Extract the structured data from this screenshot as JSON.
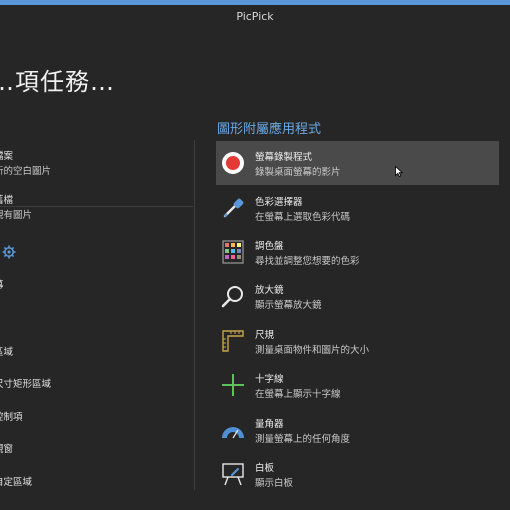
{
  "window": {
    "title": "PicPick"
  },
  "heading": "…項任務…",
  "left": {
    "items": [
      {
        "text": "檔案"
      },
      {
        "text": "新的空白圖片"
      },
      {
        "text": "舊檔"
      },
      {
        "text": "現有圖片"
      },
      {
        "text": "幕"
      },
      {
        "text": "區域"
      },
      {
        "text": "尺寸矩形區域"
      },
      {
        "text": "控制項"
      },
      {
        "text": "視窗"
      },
      {
        "text": "自定區域"
      }
    ]
  },
  "utilities": {
    "section_title": "圖形附屬應用程式",
    "items": [
      {
        "name": "螢幕錄製程式",
        "desc": "錄製桌面螢幕的影片",
        "icon": "record-icon"
      },
      {
        "name": "色彩選擇器",
        "desc": "在螢幕上選取色彩代碼",
        "icon": "eyedropper-icon"
      },
      {
        "name": "調色盤",
        "desc": "尋找並調整您想要的色彩",
        "icon": "palette-icon"
      },
      {
        "name": "放大鏡",
        "desc": "顯示螢幕放大鏡",
        "icon": "magnifier-icon"
      },
      {
        "name": "尺規",
        "desc": "測量桌面物件和圖片的大小",
        "icon": "ruler-icon"
      },
      {
        "name": "十字線",
        "desc": "在螢幕上顯示十字線",
        "icon": "crosshair-icon"
      },
      {
        "name": "量角器",
        "desc": "測量螢幕上的任何角度",
        "icon": "protractor-icon"
      },
      {
        "name": "白板",
        "desc": "顯示白板",
        "icon": "whiteboard-icon"
      }
    ]
  },
  "colors": {
    "accent": "#6aa8e6",
    "record": "#e53935",
    "crosshair": "#5cc25c",
    "hover": "#4a4a4a"
  }
}
